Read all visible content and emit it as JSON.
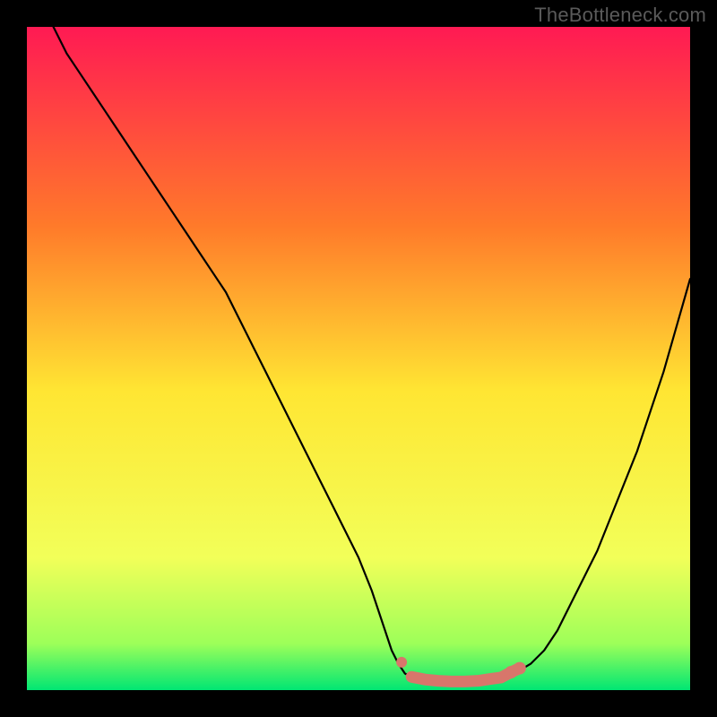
{
  "watermark": "TheBottleneck.com",
  "colors": {
    "background": "#000000",
    "gradient_top": "#ff1a53",
    "gradient_mid_upper": "#ff7a2a",
    "gradient_mid": "#ffe633",
    "gradient_low": "#f2ff59",
    "gradient_green_light": "#9dff59",
    "gradient_green": "#00e673",
    "curve": "#000000",
    "marker": "#d8766b"
  },
  "chart_data": {
    "type": "line",
    "title": "",
    "xlabel": "",
    "ylabel": "",
    "xlim": [
      0,
      100
    ],
    "ylim": [
      0,
      100
    ],
    "series": [
      {
        "name": "bottleneck-curve",
        "x": [
          4,
          6,
          8,
          10,
          12,
          14,
          16,
          18,
          20,
          22,
          24,
          26,
          28,
          30,
          32,
          34,
          36,
          38,
          40,
          42,
          44,
          46,
          48,
          50,
          52,
          54,
          55,
          56,
          57,
          58,
          60,
          62,
          64,
          66,
          68,
          70,
          72,
          74,
          76,
          78,
          80,
          82,
          84,
          86,
          88,
          90,
          92,
          94,
          96,
          98,
          100
        ],
        "y": [
          100,
          96,
          93,
          90,
          87,
          84,
          81,
          78,
          75,
          72,
          69,
          66,
          63,
          60,
          56,
          52,
          48,
          44,
          40,
          36,
          32,
          28,
          24,
          20,
          15,
          9,
          6,
          4,
          2.5,
          2,
          1.6,
          1.4,
          1.3,
          1.3,
          1.4,
          1.7,
          2.1,
          2.8,
          4,
          6,
          9,
          13,
          17,
          21,
          26,
          31,
          36,
          42,
          48,
          55,
          62
        ]
      }
    ],
    "markers": {
      "name": "highlight-band",
      "x": [
        56.5,
        58,
        60,
        62,
        64,
        66,
        68,
        70,
        71.5,
        73,
        74.3
      ],
      "y": [
        4.2,
        2.0,
        1.6,
        1.4,
        1.3,
        1.3,
        1.4,
        1.7,
        1.9,
        2.7,
        3.3
      ]
    },
    "annotations": []
  }
}
